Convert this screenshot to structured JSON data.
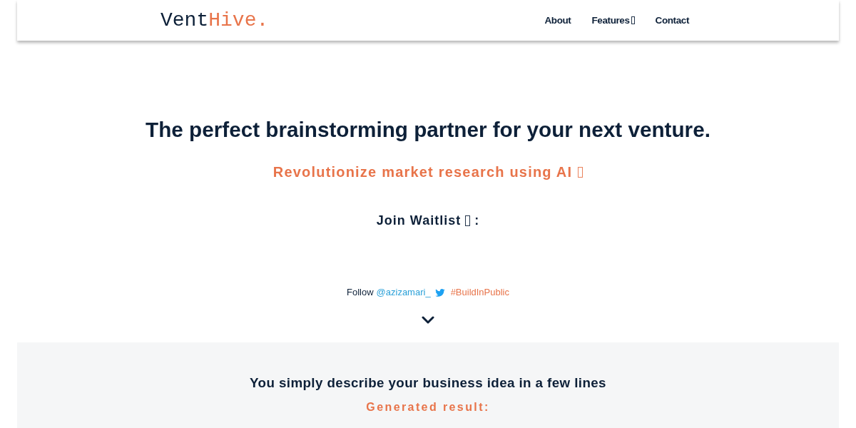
{
  "header": {
    "logo": {
      "part_1": "Vent",
      "part_2": "Hive."
    },
    "nav": [
      {
        "label": "About",
        "kind": "link"
      },
      {
        "label": "Features",
        "kind": "dropdown"
      },
      {
        "label": "Contact",
        "kind": "link"
      }
    ]
  },
  "hero": {
    "headline": "The perfect brainstorming partner for your next venture.",
    "tagline": "Revolutionize market research using AI",
    "waitlist_label": "Join Waitlist",
    "waitlist_suffix": ":",
    "follow": {
      "prefix": "Follow",
      "handle": "@azizamari_",
      "hashtag": "#BuildInPublic"
    }
  },
  "section": {
    "title": "You simply describe your business idea in a few lines",
    "subtitle": "Generated result:"
  }
}
